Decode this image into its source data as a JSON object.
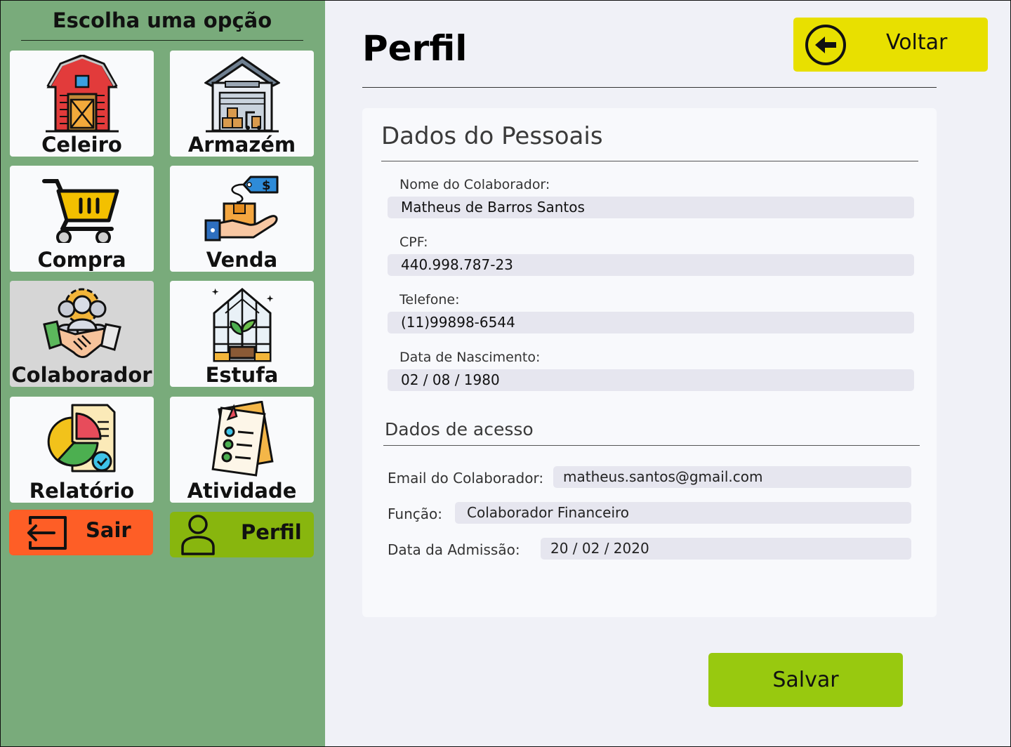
{
  "sidebar": {
    "title": "Escolha uma opção",
    "tiles": [
      {
        "label": "Celeiro",
        "icon": "barn-icon"
      },
      {
        "label": "Armazém",
        "icon": "warehouse-icon"
      },
      {
        "label": "Compra",
        "icon": "shopping-cart-icon"
      },
      {
        "label": "Venda",
        "icon": "sale-box-hand-icon"
      },
      {
        "label": "Colaborador",
        "icon": "team-handshake-icon",
        "active": true
      },
      {
        "label": "Estufa",
        "icon": "greenhouse-icon"
      },
      {
        "label": "Relatório",
        "icon": "report-chart-icon"
      },
      {
        "label": "Atividade",
        "icon": "activity-checklist-icon"
      }
    ],
    "logout_label": "Sair",
    "profile_label": "Perfil"
  },
  "header": {
    "title": "Perfil",
    "back_label": "Voltar"
  },
  "personal": {
    "title": "Dados do Pessoais",
    "name_label": "Nome do Colaborador:",
    "name_value": "Matheus de Barros Santos",
    "cpf_label": "CPF:",
    "cpf_value": "440.998.787-23",
    "phone_label": "Telefone:",
    "phone_value": "(11)99898-6544",
    "birth_label": "Data de Nascimento:",
    "birth_value": "02 / 08 / 1980"
  },
  "access": {
    "title": "Dados de acesso",
    "email_label": "Email do Colaborador:",
    "email_value": "matheus.santos@gmail.com",
    "role_label": "Função:",
    "role_value": "Colaborador Financeiro",
    "admission_label": "Data da Admissão:",
    "admission_value": "20 / 02 / 2020"
  },
  "save_label": "Salvar",
  "colors": {
    "sidebar_bg": "#79ab7b",
    "main_bg": "#f0f1f7",
    "back_button": "#e8e000",
    "save_button": "#98c90f",
    "logout_button": "#fe5e26",
    "profile_button": "#88b60e"
  }
}
